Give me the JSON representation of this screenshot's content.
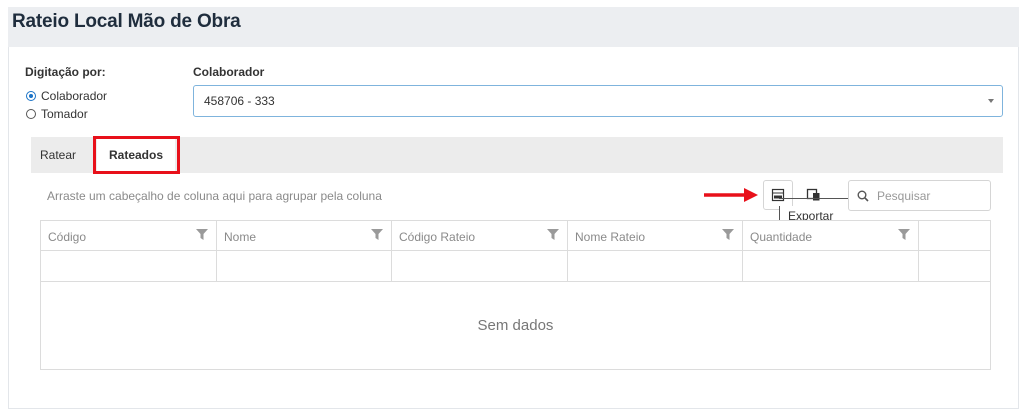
{
  "page": {
    "title": "Rateio Local Mão de Obra"
  },
  "form": {
    "digitacao_label": "Digitação por:",
    "options": [
      {
        "label": "Colaborador",
        "checked": true
      },
      {
        "label": "Tomador",
        "checked": false
      }
    ],
    "colaborador_label": "Colaborador",
    "colaborador_value": "458706 - 333"
  },
  "tabs": [
    {
      "label": "Ratear",
      "active": false
    },
    {
      "label": "Rateados",
      "active": true
    }
  ],
  "grid": {
    "group_hint": "Arraste um cabeçalho de coluna aqui para agrupar pela coluna",
    "search_placeholder": "Pesquisar",
    "export_tooltip": "Exportar",
    "columns": [
      "Código",
      "Nome",
      "Código Rateio",
      "Nome Rateio",
      "Quantidade"
    ],
    "empty_text": "Sem dados"
  },
  "colors": {
    "accent": "#1a73c7",
    "highlight": "#e8101a"
  },
  "icons": [
    "radio-icon",
    "chevron-down-icon",
    "arrow-right-icon",
    "export-excel-icon",
    "column-chooser-icon",
    "search-icon",
    "filter-icon"
  ]
}
